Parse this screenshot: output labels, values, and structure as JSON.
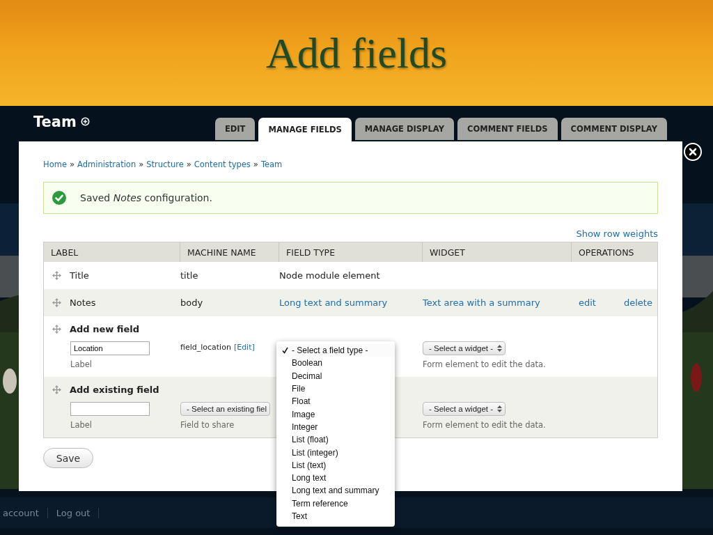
{
  "slide_title": "Add fields",
  "page": {
    "title": "Team",
    "tabs": [
      {
        "label": "EDIT",
        "selected": false
      },
      {
        "label": "MANAGE FIELDS",
        "selected": true
      },
      {
        "label": "MANAGE DISPLAY",
        "selected": false
      },
      {
        "label": "COMMENT FIELDS",
        "selected": false
      },
      {
        "label": "COMMENT DISPLAY",
        "selected": false
      }
    ],
    "breadcrumb": [
      {
        "kind": "link",
        "text": "Home"
      },
      {
        "kind": "separator",
        "text": "»"
      },
      {
        "kind": "link",
        "text": "Administration"
      },
      {
        "kind": "separator",
        "text": "»"
      },
      {
        "kind": "link",
        "text": "Structure"
      },
      {
        "kind": "separator",
        "text": "»"
      },
      {
        "kind": "link",
        "text": "Content types"
      },
      {
        "kind": "separator",
        "text": "»"
      },
      {
        "kind": "link",
        "text": "Team"
      }
    ],
    "message": "Saved *Notes* configuration.",
    "show_row_weights": "Show row weights",
    "table": {
      "columns": [
        "LABEL",
        "MACHINE NAME",
        "FIELD TYPE",
        "WIDGET",
        "OPERATIONS"
      ],
      "rows": [
        {
          "kind": "field",
          "label": "Title",
          "machine_name": "title",
          "field_type": "Node module element",
          "field_type_link": false
        },
        {
          "kind": "field",
          "label": "Notes",
          "machine_name": "body",
          "field_type": "Long text and summary",
          "field_type_link": true,
          "widget": "Text area with a summary",
          "operations": [
            "edit",
            "delete"
          ]
        },
        {
          "kind": "new",
          "label": "Add new field",
          "input_value": "Location",
          "input_caption": "Label",
          "machine_name": "field_location",
          "machine_edit": "[Edit]",
          "widget_select": "- Select a widget -",
          "widget_caption": "Form element to edit the data."
        },
        {
          "kind": "existing",
          "label": "Add existing field",
          "input_caption": "Label",
          "field_select": "- Select an existing fiel",
          "field_caption": "Field to share",
          "widget_select": "- Select a widget -",
          "widget_caption": "Form element to edit the data."
        }
      ]
    },
    "save_button": "Save",
    "field_type_dropdown": [
      {
        "label": "- Select a field type -",
        "selected": true
      },
      {
        "label": "Boolean",
        "selected": false
      },
      {
        "label": "Decimal",
        "selected": false
      },
      {
        "label": "File",
        "selected": false
      },
      {
        "label": "Float",
        "selected": false
      },
      {
        "label": "Image",
        "selected": false
      },
      {
        "label": "Integer",
        "selected": false
      },
      {
        "label": "List (float)",
        "selected": false
      },
      {
        "label": "List (integer)",
        "selected": false
      },
      {
        "label": "List (text)",
        "selected": false
      },
      {
        "label": "Long text",
        "selected": false
      },
      {
        "label": "Long text and summary",
        "selected": false
      },
      {
        "label": "Term reference",
        "selected": false
      },
      {
        "label": "Text",
        "selected": false
      }
    ],
    "footer_links": [
      "account",
      "Log out"
    ]
  }
}
